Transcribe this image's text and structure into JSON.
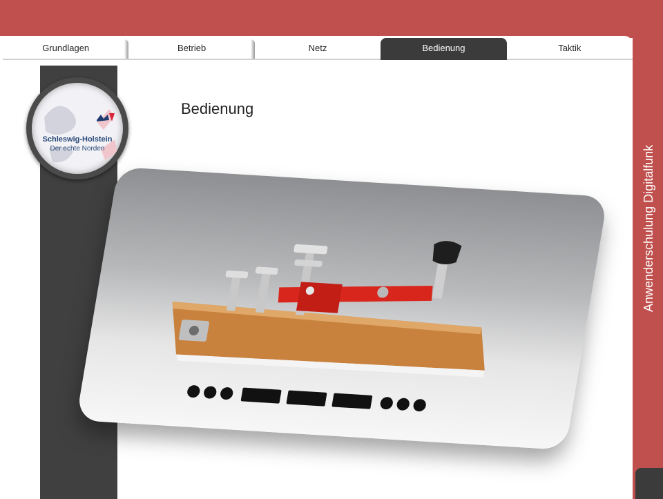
{
  "nav": {
    "tabs": [
      {
        "label": "Grundlagen"
      },
      {
        "label": "Betrieb"
      },
      {
        "label": "Netz"
      },
      {
        "label": "Bedienung"
      },
      {
        "label": "Taktik"
      }
    ],
    "active_tab": "Bedienung"
  },
  "logo": {
    "line1": "Schleswig-Holstein",
    "line2": "Der echte Norden"
  },
  "main": {
    "title": "Bedienung"
  },
  "sidebar": {
    "title": "Anwenderschulung Digitalfunk"
  },
  "image": {
    "morse_pattern": "... --- ...",
    "subject": "morse-key"
  },
  "colors": {
    "accent": "#c0504d",
    "dark": "#404040",
    "active_tab": "#3b3b3b",
    "key_red": "#d9261c",
    "wood": "#c9823e"
  }
}
